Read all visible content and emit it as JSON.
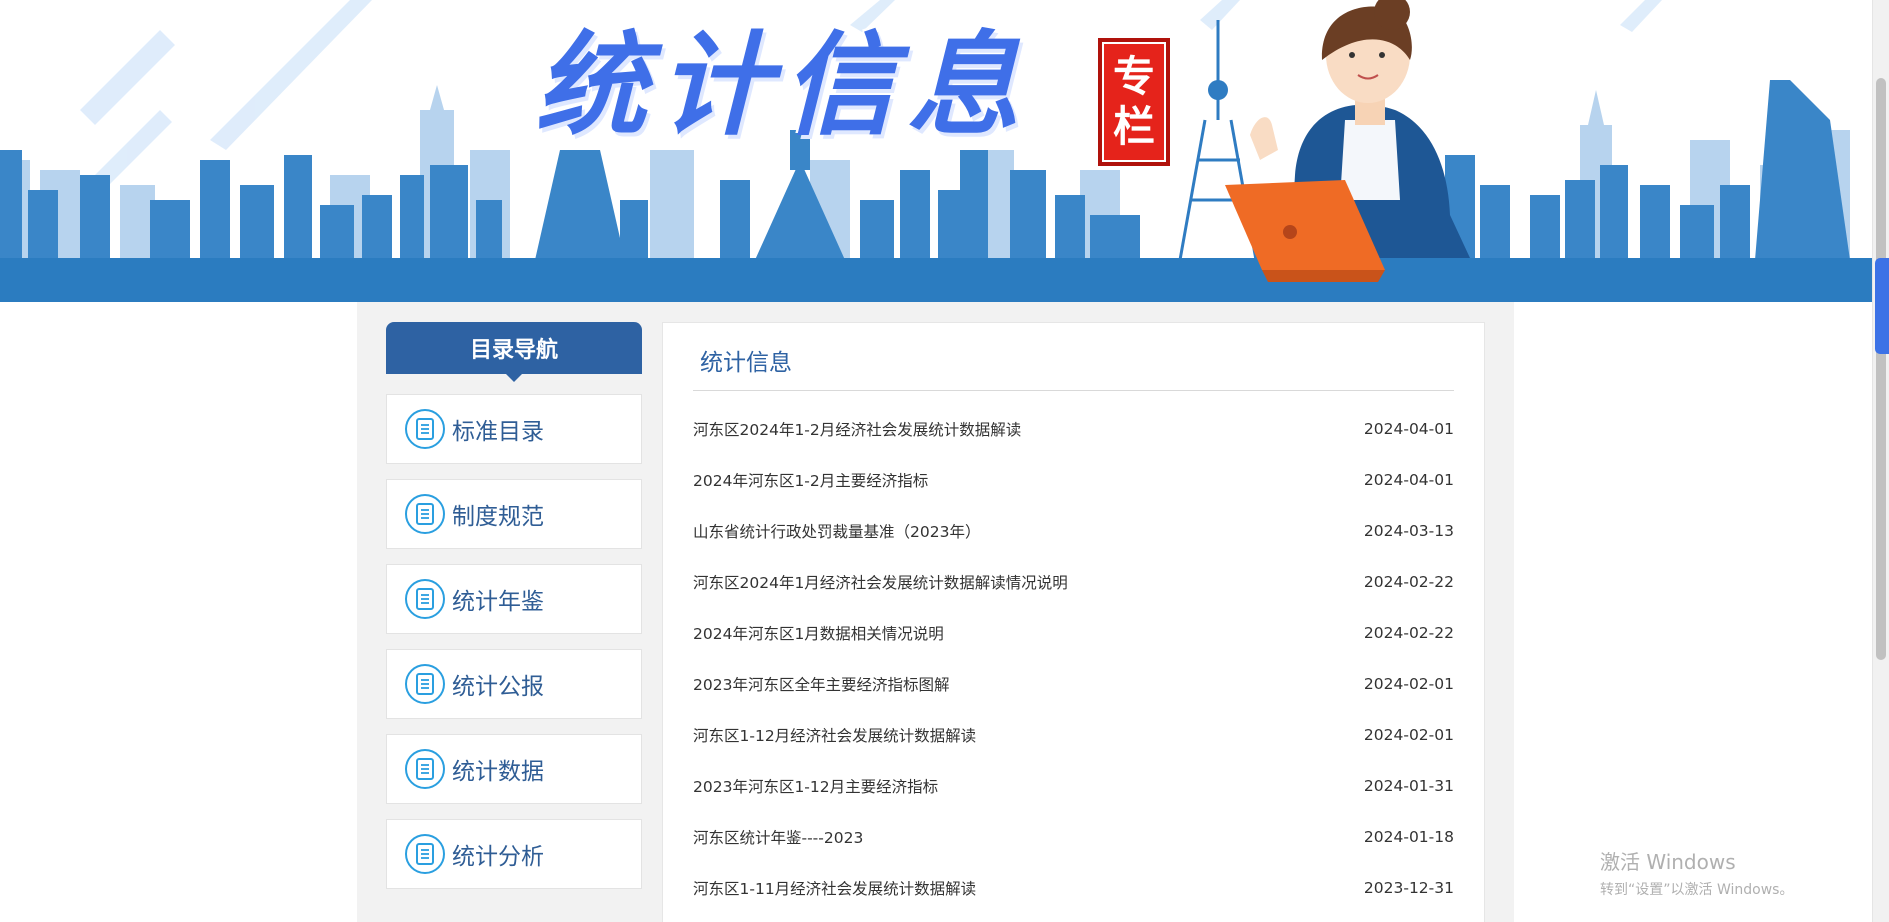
{
  "banner": {
    "title": "统计信息",
    "seal_line1": "专",
    "seal_line2": "栏"
  },
  "nav": {
    "header": "目录导航",
    "items": [
      {
        "label": "标准目录",
        "icon": "document-icon"
      },
      {
        "label": "制度规范",
        "icon": "document-icon"
      },
      {
        "label": "统计年鉴",
        "icon": "document-icon"
      },
      {
        "label": "统计公报",
        "icon": "document-icon"
      },
      {
        "label": "统计数据",
        "icon": "document-icon"
      },
      {
        "label": "统计分析",
        "icon": "document-icon"
      }
    ]
  },
  "panel": {
    "title": "统计信息",
    "items": [
      {
        "title": "河东区2024年1-2月经济社会发展统计数据解读",
        "date": "2024-04-01"
      },
      {
        "title": "2024年河东区1-2月主要经济指标",
        "date": "2024-04-01"
      },
      {
        "title": "山东省统计行政处罚裁量基准（2023年）",
        "date": "2024-03-13"
      },
      {
        "title": "河东区2024年1月经济社会发展统计数据解读情况说明",
        "date": "2024-02-22"
      },
      {
        "title": "2024年河东区1月数据相关情况说明",
        "date": "2024-02-22"
      },
      {
        "title": "2023年河东区全年主要经济指标图解",
        "date": "2024-02-01"
      },
      {
        "title": "河东区1-12月经济社会发展统计数据解读",
        "date": "2024-02-01"
      },
      {
        "title": "2023年河东区1-12月主要经济指标",
        "date": "2024-01-31"
      },
      {
        "title": "河东区统计年鉴----2023",
        "date": "2024-01-18"
      },
      {
        "title": "河东区1-11月经济社会发展统计数据解读",
        "date": "2023-12-31"
      }
    ]
  },
  "watermark": {
    "line1": "激活 Windows",
    "line2": "转到“设置”以激活 Windows。"
  },
  "colors": {
    "brand_blue": "#2e62a3",
    "icon_blue": "#2a9fe0",
    "banner_base": "#2b7cc0",
    "seal_red": "#e5231b",
    "laptop_orange": "#ef6b25"
  }
}
